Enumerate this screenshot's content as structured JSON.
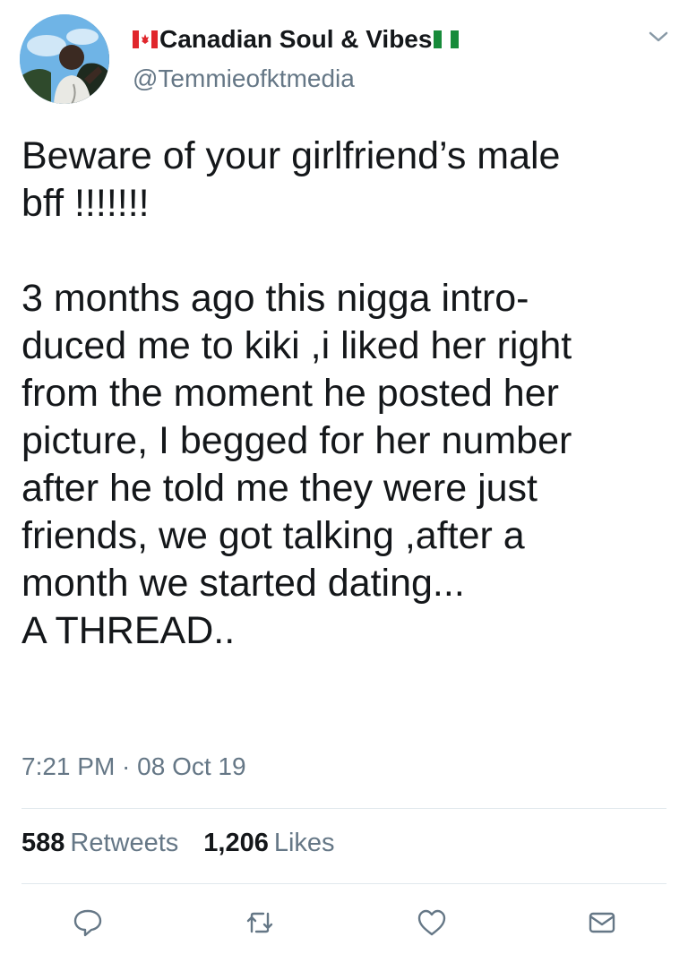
{
  "tweet": {
    "display_name": "Canadian Soul & Vibes",
    "handle": "@Temmieofktmedia",
    "text": "Beware of your girlfriend’s male\nbff !!!!!!!\n\n3 months ago this nigga intro-\nduced me to kiki ,i liked her right\nfrom the moment he posted her\npicture, I begged for her number\nafter he told me they were just\nfriends, we got talking ,after a\nmonth we started dating...\nA THREAD..",
    "timestamp": "7:21 PM · 08 Oct 19",
    "retweets_count": "588",
    "retweets_label": "Retweets",
    "likes_count": "1,206",
    "likes_label": "Likes"
  },
  "icons": {
    "flag_left": "canada-flag-icon",
    "flag_right": "nigeria-flag-icon",
    "menu": "chevron-down-icon",
    "reply": "reply-icon",
    "retweet": "retweet-icon",
    "like": "heart-icon",
    "message": "mail-icon"
  },
  "colors": {
    "text": "#14171a",
    "secondary": "#657786",
    "divider": "#e1e8ed",
    "canada_red": "#e0262c",
    "nigeria_green": "#178b3a"
  }
}
